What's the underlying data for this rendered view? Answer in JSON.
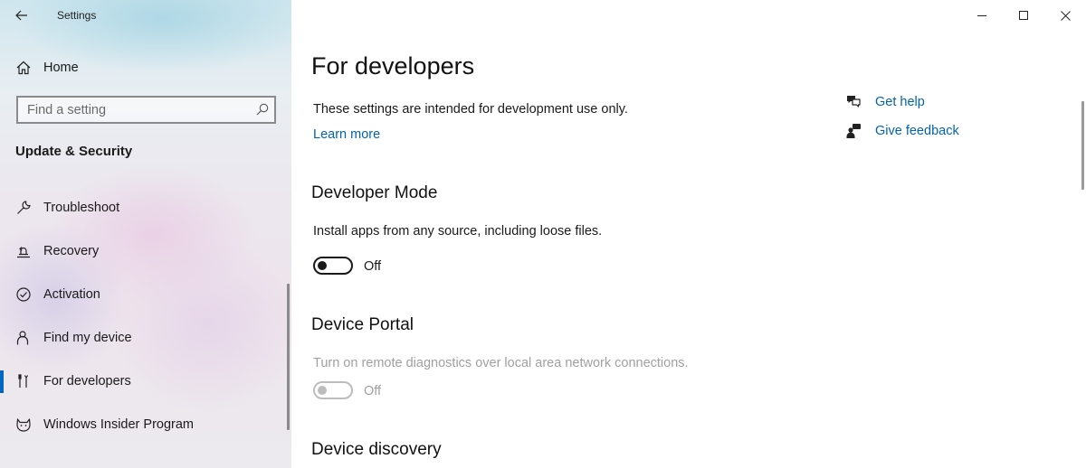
{
  "window": {
    "app_title": "Settings"
  },
  "sidebar": {
    "home_label": "Home",
    "search_placeholder": "Find a setting",
    "section_title": "Update & Security",
    "items": [
      {
        "label": "Troubleshoot",
        "icon": "wrench-icon"
      },
      {
        "label": "Recovery",
        "icon": "recovery-icon"
      },
      {
        "label": "Activation",
        "icon": "check-circle-icon"
      },
      {
        "label": "Find my device",
        "icon": "person-location-icon"
      },
      {
        "label": "For developers",
        "icon": "developer-tools-icon",
        "selected": true
      },
      {
        "label": "Windows Insider Program",
        "icon": "insider-cat-icon"
      }
    ]
  },
  "main": {
    "title": "For developers",
    "description": "These settings are intended for development use only.",
    "learn_more": "Learn more",
    "help": {
      "get_help": "Get help",
      "give_feedback": "Give feedback"
    },
    "developer_mode": {
      "heading": "Developer Mode",
      "description": "Install apps from any source, including loose files.",
      "state": "Off"
    },
    "device_portal": {
      "heading": "Device Portal",
      "description": "Turn on remote diagnostics over local area network connections.",
      "state": "Off",
      "disabled": true
    },
    "device_discovery": {
      "heading": "Device discovery"
    }
  },
  "colors": {
    "accent": "#0067c0",
    "link": "#0063b1",
    "disabled_text": "#a0a0a0"
  }
}
